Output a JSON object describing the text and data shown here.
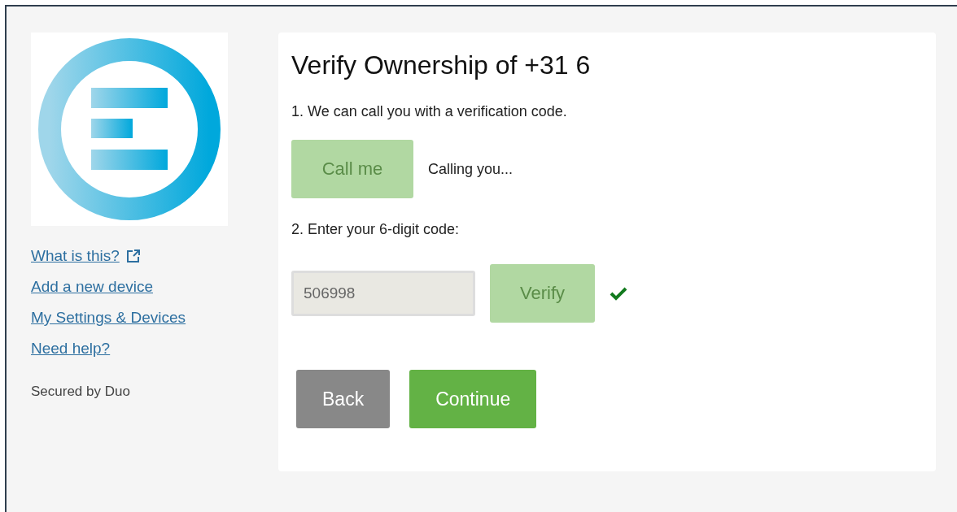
{
  "sidebar": {
    "links": [
      {
        "label": "What is this?",
        "external": true
      },
      {
        "label": "Add a new device",
        "external": false
      },
      {
        "label": "My Settings & Devices",
        "external": false
      },
      {
        "label": "Need help?",
        "external": false
      }
    ],
    "footer": "Secured by Duo"
  },
  "card": {
    "title": "Verify Ownership of +31 6",
    "step1": "1. We can call you with a verification code.",
    "call_button": {
      "label": "Call me",
      "disabled": true
    },
    "call_status": "Calling you...",
    "step2": "2. Enter your 6-digit code:",
    "code_field": {
      "value": "506998",
      "disabled": true
    },
    "verify_button": {
      "label": "Verify",
      "disabled": true
    },
    "verified": true,
    "actions": [
      {
        "label": "Back",
        "kind": "secondary"
      },
      {
        "label": "Continue",
        "kind": "primary"
      }
    ]
  }
}
